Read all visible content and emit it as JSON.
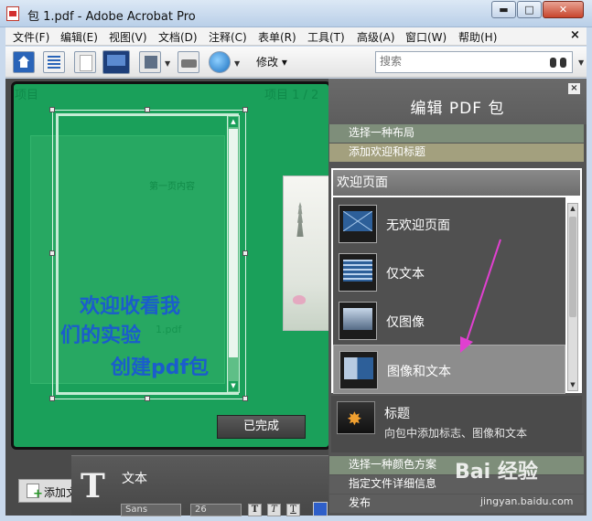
{
  "window": {
    "title": "包 1.pdf - Adobe Acrobat Pro",
    "controls": {
      "minimize": "▬",
      "maximize": "□",
      "close": "✕"
    }
  },
  "menu": {
    "items": [
      "文件(F)",
      "编辑(E)",
      "视图(V)",
      "文档(D)",
      "注释(C)",
      "表单(R)",
      "工具(T)",
      "高级(A)",
      "窗口(W)",
      "帮助(H)"
    ],
    "close": "×"
  },
  "toolbar": {
    "modify_label": "修改",
    "search_placeholder": "搜索",
    "icons": [
      "home-icon",
      "list-view-icon",
      "page-view-icon",
      "layout-icon",
      "save-icon",
      "print-icon",
      "globe-icon",
      "binoculars-icon"
    ]
  },
  "document": {
    "welcome_lines": [
      "欢迎收看我",
      "们的实验",
      "创建pdf包"
    ],
    "faint_header_left": "项目",
    "faint_header_right": "项目 1 / 2",
    "faint_inner_title": "第一页内容",
    "faint_file": "1.pdf",
    "done_label": "已完成"
  },
  "bottom": {
    "add_file_label": "添加文件",
    "text_panel_label": "文本",
    "font_value": "Sans",
    "size_value": "26",
    "format_buttons": [
      "T",
      "T",
      "T"
    ]
  },
  "right_panel": {
    "title": "编辑 PDF 包",
    "close": "×",
    "steps": {
      "layout": "选择一种布局",
      "welcome": "添加欢迎和标题",
      "color": "选择一种颜色方案",
      "details": "指定文件详细信息",
      "publish": "发布"
    },
    "welcome_section_header": "欢迎页面",
    "options": [
      {
        "label": "无欢迎页面",
        "icon": "no-welcome-icon"
      },
      {
        "label": "仅文本",
        "icon": "text-only-icon"
      },
      {
        "label": "仅图像",
        "icon": "image-only-icon"
      },
      {
        "label": "图像和文本",
        "icon": "image-text-icon"
      }
    ],
    "title_option": {
      "label": "标题",
      "description": "向包中添加标志、图像和文本"
    }
  },
  "watermark": {
    "brand": "Bai 经验",
    "url": "jingyan.baidu.com"
  },
  "colors": {
    "green": "#1aa05a",
    "welcome_text": "#1b5dcc",
    "annotation_arrow": "#e040d0"
  }
}
